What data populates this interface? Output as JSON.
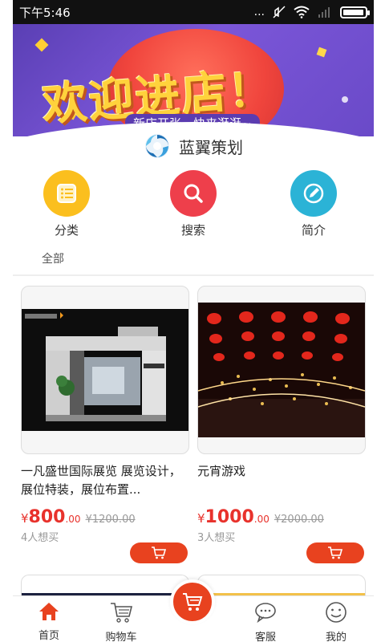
{
  "status_bar": {
    "time": "下午5:46",
    "dots": "...",
    "battery": "full"
  },
  "banner": {
    "title": "欢迎进店！",
    "subtitle": "新店开张，快来逛逛~"
  },
  "brand": {
    "name": "蓝翼策划",
    "logo": "blue-swirl-logo"
  },
  "quick_nav": [
    {
      "label": "分类",
      "icon": "list-icon",
      "color": "#fbbf1e"
    },
    {
      "label": "搜索",
      "icon": "search-icon",
      "color": "#ee3f4b"
    },
    {
      "label": "简介",
      "icon": "edit-icon",
      "color": "#2bb3d6"
    }
  ],
  "filter": {
    "label": "全部"
  },
  "products": [
    {
      "title": "一凡盛世国际展览 展览设计，展位特装，展位布置...",
      "currency": "¥",
      "price_int": "800",
      "price_dec": ".00",
      "price_old": "¥1200.00",
      "want": "4人想买",
      "image": "exhibition-booth-image"
    },
    {
      "title": "元宵游戏",
      "currency": "¥",
      "price_int": "1000",
      "price_dec": ".00",
      "price_old": "¥2000.00",
      "want": "3人想买",
      "image": "red-lanterns-image"
    }
  ],
  "tabs": [
    {
      "label": "首页",
      "icon": "home-icon",
      "active": true
    },
    {
      "label": "购物车",
      "icon": "cart-icon"
    },
    {
      "label": "客服",
      "icon": "chat-icon"
    },
    {
      "label": "我的",
      "icon": "smile-icon"
    }
  ],
  "colors": {
    "accent": "#e8421f",
    "price": "#e8322c"
  }
}
